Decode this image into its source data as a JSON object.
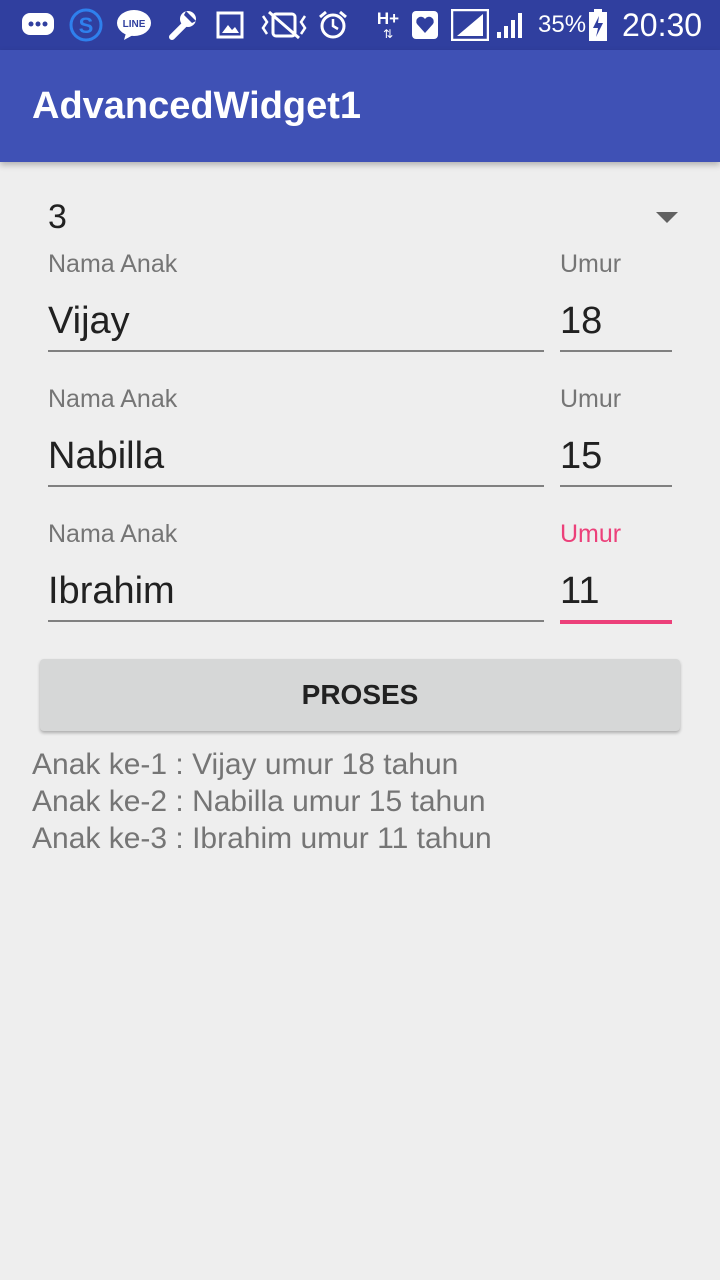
{
  "status_bar": {
    "icons": [
      "chat-bubble-icon",
      "s-app-icon",
      "line-app-icon",
      "wrench-icon",
      "image-icon",
      "vibrate-mute-icon",
      "alarm-icon",
      "hplus-data-icon",
      "heart-app-icon",
      "wifi-signal-icon",
      "cell-signal-icon",
      "battery-charging-icon"
    ],
    "line_label": "LINE",
    "network_label": "H+",
    "battery_percent": "35%",
    "time": "20:30"
  },
  "app_bar": {
    "title": "AdvancedWidget1"
  },
  "spinner": {
    "selected": "3",
    "icon": "dropdown-arrow-icon"
  },
  "children": [
    {
      "name_label": "Nama Anak",
      "name_value": "Vijay",
      "age_label": "Umur",
      "age_value": "18"
    },
    {
      "name_label": "Nama Anak",
      "name_value": "Nabilla",
      "age_label": "Umur",
      "age_value": "15"
    },
    {
      "name_label": "Nama Anak",
      "name_value": "Ibrahim",
      "age_label": "Umur",
      "age_value": "11"
    }
  ],
  "button": {
    "label": "PROSES"
  },
  "results": [
    "Anak ke-1 : Vijay umur 18 tahun",
    "Anak ke-2 : Nabilla umur 15 tahun",
    "Anak ke-3 : Ibrahim umur 11 tahun"
  ],
  "colors": {
    "status_bar": "#303f9f",
    "app_bar": "#3f51b5",
    "accent": "#ec407a",
    "background": "#eeeeee",
    "button": "#d6d7d7"
  }
}
